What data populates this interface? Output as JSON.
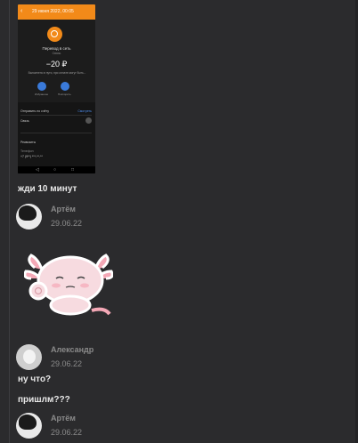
{
  "screenshot": {
    "header_date": "29 июня 2022, 00:05",
    "merchant": "Перевод в сеть",
    "subtitle": "Связь",
    "amount": "−20 ₽",
    "note": "Выполнено в пути, при оплате могут быть...",
    "buttons": [
      "Избранное",
      "Повторить"
    ],
    "panel_title": "Отправить по счёту",
    "panel_link": "Смотреть",
    "row1": "Связь",
    "row2": "Реквизиты",
    "row3_label": "Телефон",
    "row3_value": "+7 (9**) ***-**-**",
    "colors": {
      "accent": "#f28a19",
      "link": "#4f8ff0"
    }
  },
  "messages": [
    {
      "text": "жди 10 минут"
    },
    {
      "author": "Артём",
      "date": "29.06.22",
      "sticker": "axolotl-ok-sticker"
    },
    {
      "author": "Александр",
      "date": "29.06.22"
    },
    {
      "text": "ну что?"
    },
    {
      "text": "пришлм???"
    },
    {
      "author": "Артём",
      "date": "29.06.22"
    }
  ]
}
